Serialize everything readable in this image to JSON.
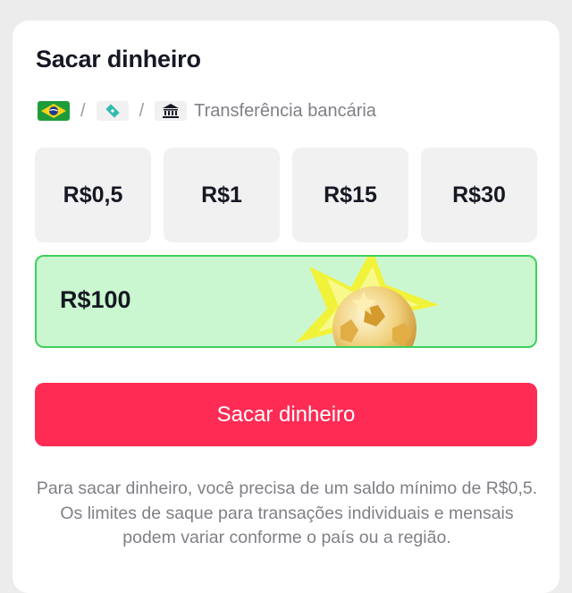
{
  "header": {
    "title": "Sacar dinheiro"
  },
  "methods": {
    "icons": [
      "brazil-flag-icon",
      "pix-icon",
      "bank-icon"
    ],
    "separator": "/",
    "bank_label": "Transferência bancária"
  },
  "amounts": {
    "options": [
      "R$0,5",
      "R$1",
      "R$15",
      "R$30"
    ],
    "selected": "R$100"
  },
  "cta": {
    "label": "Sacar dinheiro",
    "color": "#fe2c55"
  },
  "note": {
    "text": "Para sacar dinheiro, você precisa de um saldo mínimo de R$0,5. Os limites de saque para transações individuais e mensais podem variar conforme o país ou a região."
  },
  "colors": {
    "selected_bg": "#cbf7d0",
    "selected_border": "#3ed15a",
    "tile_bg": "#f1f1f2"
  }
}
